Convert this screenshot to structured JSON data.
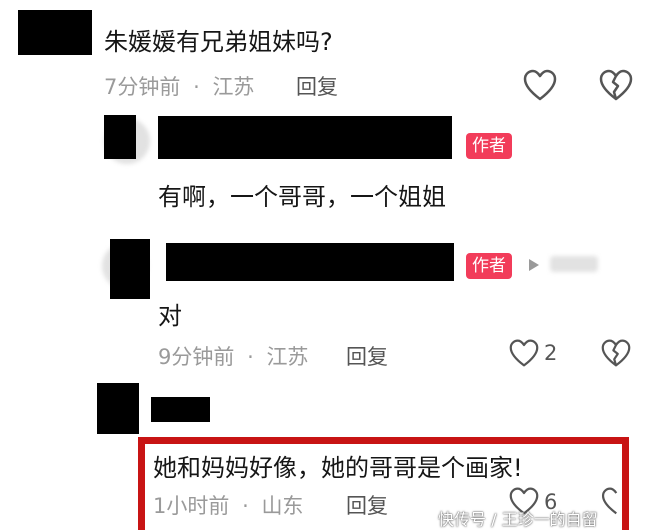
{
  "comments": [
    {
      "text": "朱媛媛有兄弟姐妹吗?",
      "time": "7分钟前",
      "separator": "·",
      "location": "江苏",
      "reply_label": "回复",
      "like_count": ""
    },
    {
      "badge": "作者",
      "text": "有啊，一个哥哥，一个姐姐"
    },
    {
      "badge": "作者",
      "text": "对",
      "time": "9分钟前",
      "separator": "·",
      "location": "江苏",
      "reply_label": "回复",
      "like_count": "2"
    },
    {
      "text": "她和妈妈好像，她的哥哥是个画家!",
      "time": "1小时前",
      "separator": "·",
      "location": "山东",
      "reply_label": "回复",
      "like_count": "6"
    }
  ],
  "icons": {
    "like": "heart-outline-icon",
    "dislike": "broken-heart-icon",
    "reply_arrow": "play-arrow-icon"
  },
  "colors": {
    "author_badge": "#f23c5a",
    "highlight_border": "#c81414",
    "meta_text": "#9a9a9a"
  },
  "watermark": {
    "text": "快传号 / 王珍一的自留"
  }
}
